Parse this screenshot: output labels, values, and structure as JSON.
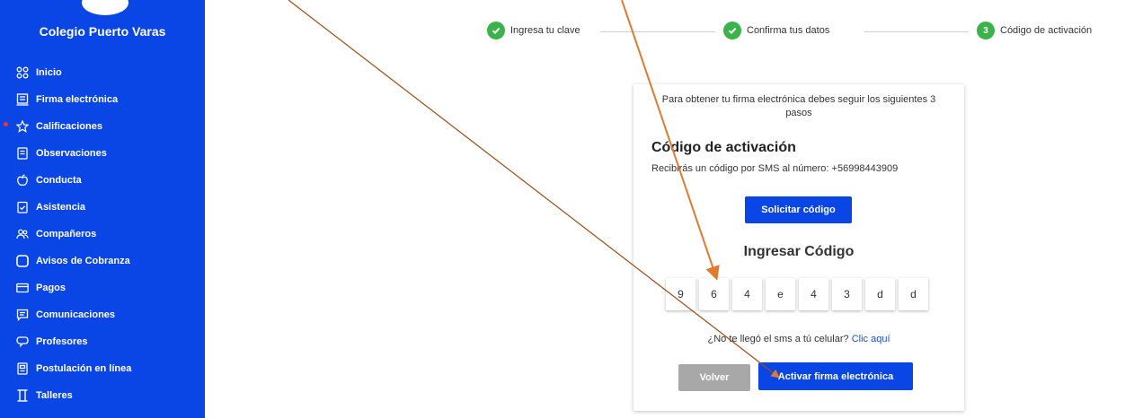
{
  "sidebar": {
    "school_name": "Colegio Puerto Varas",
    "items": [
      {
        "label": "Inicio",
        "icon": "grid-icon"
      },
      {
        "label": "Firma electrónica",
        "icon": "signature-document-icon"
      },
      {
        "label": "Calificaciones",
        "icon": "star-icon"
      },
      {
        "label": "Observaciones",
        "icon": "document-lines-icon"
      },
      {
        "label": "Conducta",
        "icon": "apple-icon"
      },
      {
        "label": "Asistencia",
        "icon": "clipboard-check-icon"
      },
      {
        "label": "Compañeros",
        "icon": "people-icon"
      },
      {
        "label": "Avisos de Cobranza",
        "icon": "rounded-square-icon"
      },
      {
        "label": "Pagos",
        "icon": "credit-card-icon"
      },
      {
        "label": "Comunicaciones",
        "icon": "message-icon"
      },
      {
        "label": "Profesores",
        "icon": "speech-bubble-icon"
      },
      {
        "label": "Postulación en línea",
        "icon": "form-icon"
      },
      {
        "label": "Talleres",
        "icon": "hourglass-icon"
      }
    ]
  },
  "stepper": {
    "steps": [
      {
        "label": "Ingresa tu clave",
        "status": "done"
      },
      {
        "label": "Confirma tus datos",
        "status": "done"
      },
      {
        "label": "Código de activación",
        "status": "active",
        "number": "3"
      }
    ]
  },
  "card": {
    "intro": "Para obtener tu firma electrónica debes seguir los siguientes 3 pasos",
    "title": "Código de activación",
    "subtitle": "Recibirás un código por SMS al número: +56998443909",
    "request_button": "Solicitar código",
    "code_title": "Ingresar Código",
    "code_digits": [
      "9",
      "6",
      "4",
      "e",
      "4",
      "3",
      "d",
      "d"
    ],
    "no_sms_text": "¿No te llegó el sms a tú celular?",
    "no_sms_link": "Clic aquí",
    "back_button": "Volver",
    "activate_button": "Activar firma electrónica"
  },
  "colors": {
    "sidebar_bg": "#0a45e6",
    "primary_button": "#0a45e6",
    "secondary_button": "#a8a8a8",
    "step_done": "#3ab34a",
    "annotation_arrow": "#e07b2c"
  }
}
